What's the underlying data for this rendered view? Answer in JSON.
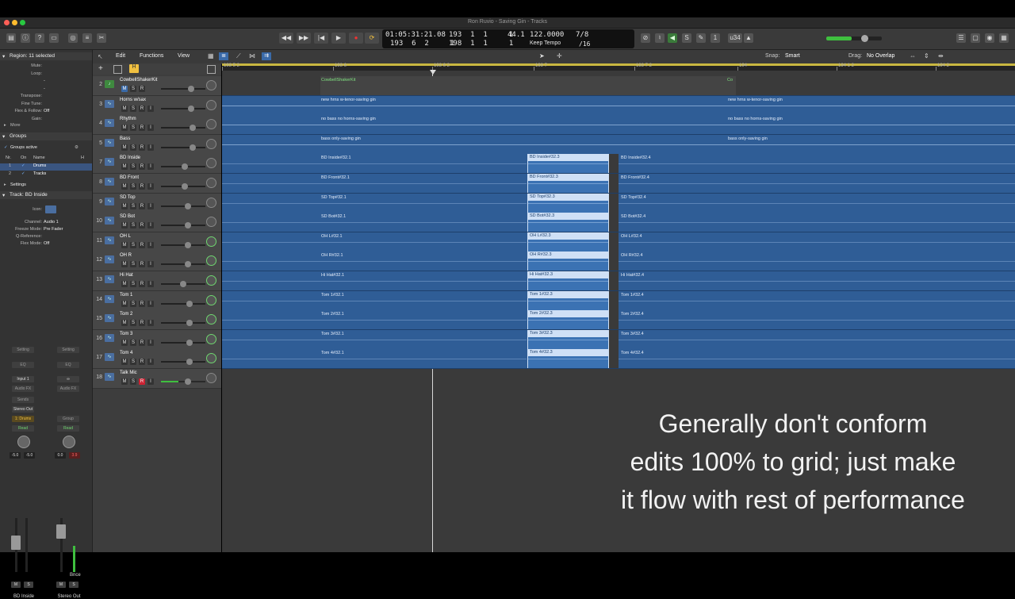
{
  "window": {
    "title": "Ron Ruvio - Saving Gin - Tracks"
  },
  "transport": {
    "time": "01:05:31:21.08",
    "bars_top": "193  1  1     1",
    "bars_bottom": "193  6  2     1",
    "bars_bottom2": "198  1  1     1",
    "tempo": "44.1",
    "bpm": "122.0000",
    "tempo_mode": "Keep Tempo",
    "signature": "7/8",
    "division": "/16",
    "count_label": "u34"
  },
  "inspector": {
    "region_header": "Region: 11 selected",
    "region_fields": [
      {
        "k": "Mute:",
        "v": ""
      },
      {
        "k": "Loop:",
        "v": ""
      },
      {
        "k": "",
        "v": "-"
      },
      {
        "k": "",
        "v": "-"
      },
      {
        "k": "Transpose:",
        "v": ""
      },
      {
        "k": "Fine Tune:",
        "v": ""
      },
      {
        "k": "Flex & Follow:",
        "v": "Off"
      },
      {
        "k": "Gain:",
        "v": ""
      }
    ],
    "more_label": "More",
    "groups_header": "Groups",
    "groups_active": "Groups active",
    "groups_cols": [
      "Nr.",
      "On",
      "Name",
      "H"
    ],
    "groups": [
      {
        "nr": "1",
        "name": "Drums"
      },
      {
        "nr": "2",
        "name": "Tracks"
      }
    ],
    "settings_label": "Settings",
    "track_header": "Track: BD Inside",
    "track_fields": [
      {
        "k": "Icon:",
        "v": ""
      },
      {
        "k": "Channel:",
        "v": "Audio 1"
      },
      {
        "k": "Freeze Mode:",
        "v": "Pre Fader"
      },
      {
        "k": "Q-Reference:",
        "v": ""
      },
      {
        "k": "Flex Mode:",
        "v": "Off"
      }
    ],
    "strip1": {
      "setting": "Setting",
      "eq": "EQ",
      "input": "Input 1",
      "audio_fx": "Audio FX",
      "sends": "Sends",
      "output": "Stereo Out",
      "group": "1: Drums",
      "auto": "Read",
      "vol_a": "-5.0",
      "vol_b": "-5.0",
      "m": "M",
      "s": "S",
      "name": "BD Inside"
    },
    "strip2": {
      "setting": "Setting",
      "eq": "EQ",
      "audio_fx": "Audio FX",
      "group": "Group",
      "auto": "Read",
      "vol_a": "0.0",
      "vol_b": "3.9",
      "bnce": "Bnce",
      "m": "M",
      "s": "S",
      "name": "Stereo Out"
    }
  },
  "menus": {
    "edit": "Edit",
    "functions": "Functions",
    "view": "View",
    "snap_label": "Snap:",
    "snap_value": "Smart",
    "drag_label": "Drag:",
    "drag_value": "No Overlap"
  },
  "ruler": [
    "193 5 2",
    "193 6",
    "193 6 2",
    "193 7",
    "193 7 2",
    "194",
    "194 1 2",
    "194 2"
  ],
  "tracks": [
    {
      "num": "2",
      "name": "CowbellShakerKit",
      "type": "midi",
      "regions": [
        {
          "label": "CowbellShakerKit"
        },
        {
          "label": "Co"
        }
      ]
    },
    {
      "num": "3",
      "name": "Horns w/sax",
      "regions": [
        {
          "label": "new hrns w-tenor-saving gin"
        },
        {
          "label": "new hrns w-tenor-saving gin"
        }
      ]
    },
    {
      "num": "4",
      "name": "Rhythm",
      "regions": [
        {
          "label": "no bass no horns-saving gin"
        },
        {
          "label": "no bass no horns-saving gin"
        }
      ]
    },
    {
      "num": "5",
      "name": "Bass",
      "regions": [
        {
          "label": "bass only-saving gin"
        },
        {
          "label": "bass only-saving gin"
        }
      ]
    },
    {
      "num": "7",
      "name": "BD Inside",
      "regions": [
        {
          "label": "BD Inside#32.1"
        },
        {
          "label": "BD Inside#32.3"
        },
        {
          "label": "BD Inside#32.4"
        }
      ]
    },
    {
      "num": "8",
      "name": "BD Front",
      "regions": [
        {
          "label": "BD Front#32.1"
        },
        {
          "label": "BD Front#32.3"
        },
        {
          "label": "BD Front#32.4"
        }
      ]
    },
    {
      "num": "9",
      "name": "SD Top",
      "regions": [
        {
          "label": "SD Top#32.1"
        },
        {
          "label": "SD Top#32.3"
        },
        {
          "label": "SD Top#32.4"
        }
      ]
    },
    {
      "num": "10",
      "name": "SD Bot",
      "regions": [
        {
          "label": "SD Bot#32.1"
        },
        {
          "label": "SD Bot#32.3"
        },
        {
          "label": "SD Bot#32.4"
        }
      ]
    },
    {
      "num": "11",
      "name": "OH L",
      "regions": [
        {
          "label": "OH L#32.1"
        },
        {
          "label": "OH L#32.3"
        },
        {
          "label": "OH L#32.4"
        }
      ]
    },
    {
      "num": "12",
      "name": "OH R",
      "regions": [
        {
          "label": "OH R#32.1"
        },
        {
          "label": "OH R#32.3"
        },
        {
          "label": "OH R#32.4"
        }
      ]
    },
    {
      "num": "13",
      "name": "Hi Hat",
      "regions": [
        {
          "label": "Hi Hat#32.1"
        },
        {
          "label": "Hi Hat#32.3"
        },
        {
          "label": "Hi Hat#32.4"
        }
      ]
    },
    {
      "num": "14",
      "name": "Tom 1",
      "regions": [
        {
          "label": "Tom 1#32.1"
        },
        {
          "label": "Tom 1#32.3"
        },
        {
          "label": "Tom 1#32.4"
        }
      ]
    },
    {
      "num": "15",
      "name": "Tom 2",
      "regions": [
        {
          "label": "Tom 2#32.1"
        },
        {
          "label": "Tom 2#32.3"
        },
        {
          "label": "Tom 2#32.4"
        }
      ]
    },
    {
      "num": "16",
      "name": "Tom 3",
      "regions": [
        {
          "label": "Tom 3#32.1"
        },
        {
          "label": "Tom 3#32.3"
        },
        {
          "label": "Tom 3#32.4"
        }
      ]
    },
    {
      "num": "17",
      "name": "Tom 4",
      "regions": [
        {
          "label": "Tom 4#32.1"
        },
        {
          "label": "Tom 4#32.3"
        },
        {
          "label": "Tom 4#32.4"
        }
      ]
    },
    {
      "num": "18",
      "name": "Talk Mic",
      "regions": []
    }
  ],
  "track_buttons": {
    "m": "M",
    "s": "S",
    "r": "R",
    "i": "I"
  },
  "caption": {
    "line1": "Generally don't conform",
    "line2": "edits 100% to grid; just make",
    "line3": "it flow with rest of performance"
  },
  "colors": {
    "region": "#2f5d96",
    "region_selected": "#3b72b3",
    "ruler_bar": "#c9b740",
    "accent_green": "#3fbf3f",
    "record": "#d63b3b"
  }
}
